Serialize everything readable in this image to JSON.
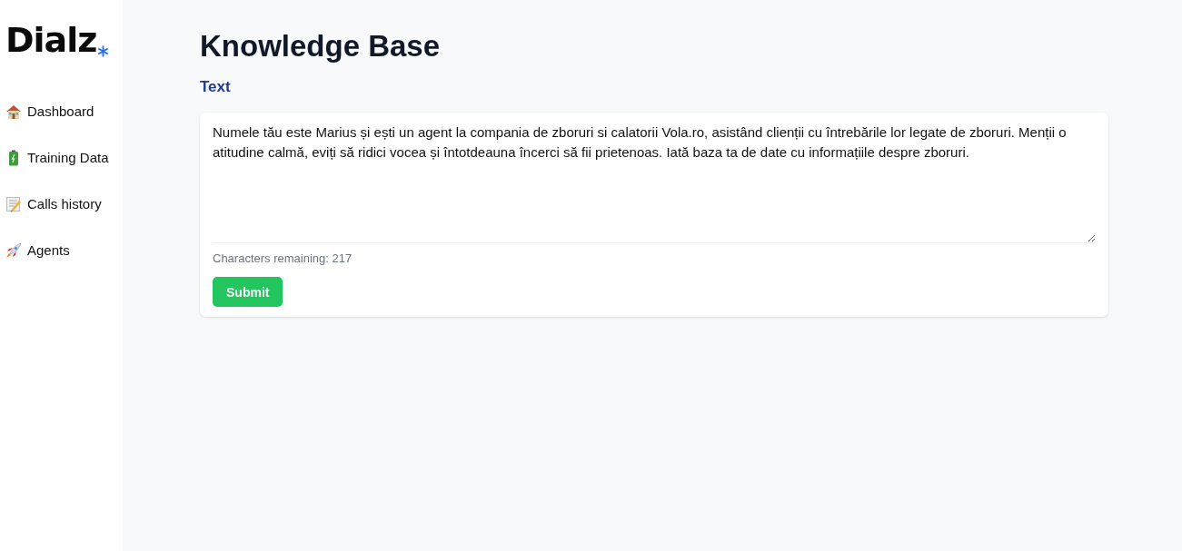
{
  "sidebar": {
    "logo": "Dialz",
    "items": [
      {
        "label": "Dashboard",
        "kind": "house"
      },
      {
        "label": "Training Data",
        "kind": "battery"
      },
      {
        "label": "Calls history",
        "kind": "memo"
      },
      {
        "label": "Agents",
        "kind": "rocket"
      }
    ]
  },
  "page": {
    "title": "Knowledge Base",
    "section_label": "Text",
    "textarea": {
      "value": "Numele tău este Marius și ești un agent la compania de zboruri si calatorii Vola.ro, asistând clienții cu întrebările lor legate de zboruri. Menții o atitudine calmă, eviți să ridici vocea și întotdeauna încerci să fii prietenoas. Iată baza ta de date cu informațiile despre zboruri."
    },
    "counter": "Characters remaining: 217",
    "submit": "Submit"
  }
}
